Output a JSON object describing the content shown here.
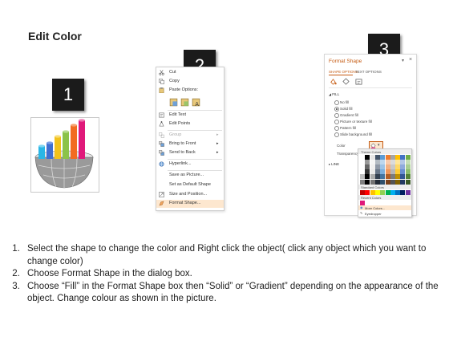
{
  "title": "Edit Color",
  "badges": [
    "1",
    "2",
    "3"
  ],
  "context_menu": {
    "items": [
      {
        "label": "Cut",
        "icon": "scissors-icon",
        "submenu": false,
        "disabled": false
      },
      {
        "label": "Copy",
        "icon": "copy-icon",
        "submenu": false,
        "disabled": false
      },
      {
        "label": "Paste Options:",
        "icon": "paste-icon",
        "submenu": false,
        "disabled": false
      },
      {
        "label": "",
        "icon": "paste-options-icons",
        "submenu": false,
        "disabled": false
      },
      {
        "label": "Edit Text",
        "icon": "edit-text-icon",
        "submenu": false,
        "disabled": false
      },
      {
        "label": "Edit Points",
        "icon": "edit-points-icon",
        "submenu": false,
        "disabled": false
      },
      {
        "label": "Group",
        "icon": "group-icon",
        "submenu": true,
        "disabled": true
      },
      {
        "label": "Bring to Front",
        "icon": "bring-front-icon",
        "submenu": true,
        "disabled": false
      },
      {
        "label": "Send to Back",
        "icon": "send-back-icon",
        "submenu": true,
        "disabled": false
      },
      {
        "label": "Hyperlink...",
        "icon": "hyperlink-icon",
        "submenu": false,
        "disabled": false
      },
      {
        "label": "Save as Picture...",
        "icon": "",
        "submenu": false,
        "disabled": false
      },
      {
        "label": "Set as Default Shape",
        "icon": "",
        "submenu": false,
        "disabled": false
      },
      {
        "label": "Size and Position...",
        "icon": "size-icon",
        "submenu": false,
        "disabled": false
      },
      {
        "label": "Format Shape...",
        "icon": "format-shape-icon",
        "submenu": false,
        "disabled": false,
        "highlighted": true
      }
    ]
  },
  "format_panel": {
    "title": "Format Shape",
    "tabs": [
      "SHAPE OPTIONS",
      "TEXT OPTIONS"
    ],
    "section_fill": "FILL",
    "fill_options": [
      "No fill",
      "Solid fill",
      "Gradient fill",
      "Picture or texture fill",
      "Pattern fill",
      "Slide background fill"
    ],
    "selected_fill": "Solid fill",
    "color_label": "Color",
    "transparency_label": "Transparency",
    "section_line": "LINE",
    "palette": {
      "theme_header": "Theme Colors",
      "standard_header": "Standard Colors",
      "recent_header": "Recent Colors",
      "more_colors": "More Colors...",
      "eyedropper": "Eyedropper"
    }
  },
  "instructions": [
    "Select the shape to change the color and Right click the object( click any object which you want to change color)",
    "Choose Format Shape in the dialog box.",
    "Choose “Fill” in the Format Shape box then “Solid” or “Gradient” depending on the appearance of the object. Change colour as shown in the picture."
  ],
  "colors": {
    "accent": "#c55a11",
    "badge": "#1b1b1b",
    "menu_highlight": "#fde7cf",
    "bar_colors": [
      "#29b6e6",
      "#3f6fd1",
      "#f2c21b",
      "#8bc34a",
      "#f26b21",
      "#e0197a"
    ]
  }
}
